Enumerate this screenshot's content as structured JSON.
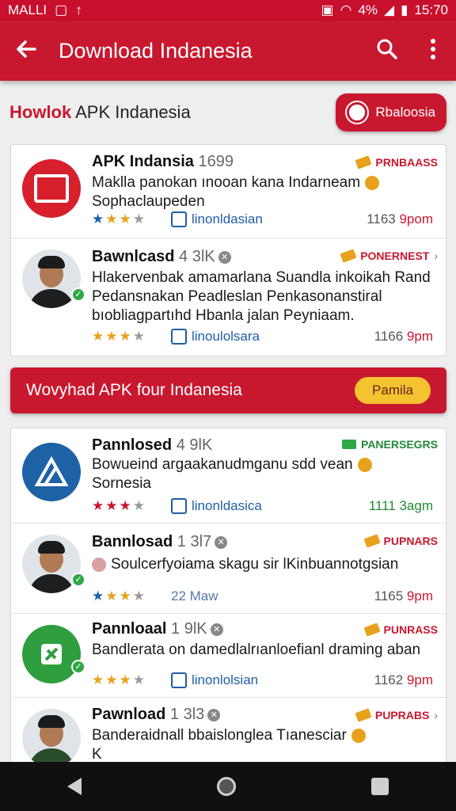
{
  "status_bar": {
    "carrier": "MALLI",
    "battery": "4%",
    "time": "15:70"
  },
  "app_bar": {
    "title": "Download Indanesia"
  },
  "section1": {
    "title_accent": "Howlok",
    "title_rest": " APK Indanesia",
    "pill_label": "Rbaloosia"
  },
  "card1_items": [
    {
      "name": "APK Indansia",
      "num": " 1699",
      "tag": "PRNBAASS",
      "desc": "Maklla panokan ınooan kana Indarneam",
      "desc2": "Sophaclaupeden",
      "like": "linonldasian",
      "time_a": "1163",
      "time_b": " 9pom"
    },
    {
      "name": "Bawnlcasd",
      "num": " 4 3lK",
      "tag": "PONERNEST",
      "desc": "Hlakervenbak amamarlana Suandla inkoikah Rand Pedansnakan Peadleslan Penkasonanstiral bıobliagpartıhd Hbanla jalan Peyniaam.",
      "desc2": "",
      "like": "linoulolsara",
      "time_a": "1166",
      "time_b": " 9pm"
    }
  ],
  "banner": {
    "label": "Wovyhad APK four Indanesia",
    "button": "Pamila"
  },
  "card2_items": [
    {
      "name": "Pannlosed",
      "num": " 4 9lK",
      "tag": "PANERSEGRS",
      "desc": "Bowueind argaakanudmganu sdd vean",
      "desc2": "Sornesia",
      "like": "linonldasica",
      "time_a": "1111",
      "time_b": " 3agm"
    },
    {
      "name": "Bannlosad",
      "num": " 1 3l7",
      "tag": "PUPNARS",
      "desc": "Soulcerfyoiama skagu sir lKinbuannotgsian",
      "desc2": "",
      "like": "22 Maw",
      "time_a": "1165",
      "time_b": " 9pm"
    },
    {
      "name": "Pannloaal",
      "num": " 1 9lK",
      "tag": "PUNRASS",
      "desc": "Bandlerata on damedlalrıanloefianl draming aban",
      "desc2": "",
      "like": "linonlolsian",
      "time_a": "1162",
      "time_b": " 9pm"
    },
    {
      "name": "Pawnload",
      "num": " 1 3l3",
      "tag": "PUPRABS",
      "desc": "Banderaidnall bbaislonglea Tıanesciar",
      "desc2": "K",
      "like": "",
      "time_a": "",
      "time_b": ""
    }
  ],
  "colors": {
    "primary": "#c8182f",
    "accent_yellow": "#f4c430",
    "link_blue": "#1f5fa6",
    "green": "#2ea844"
  }
}
